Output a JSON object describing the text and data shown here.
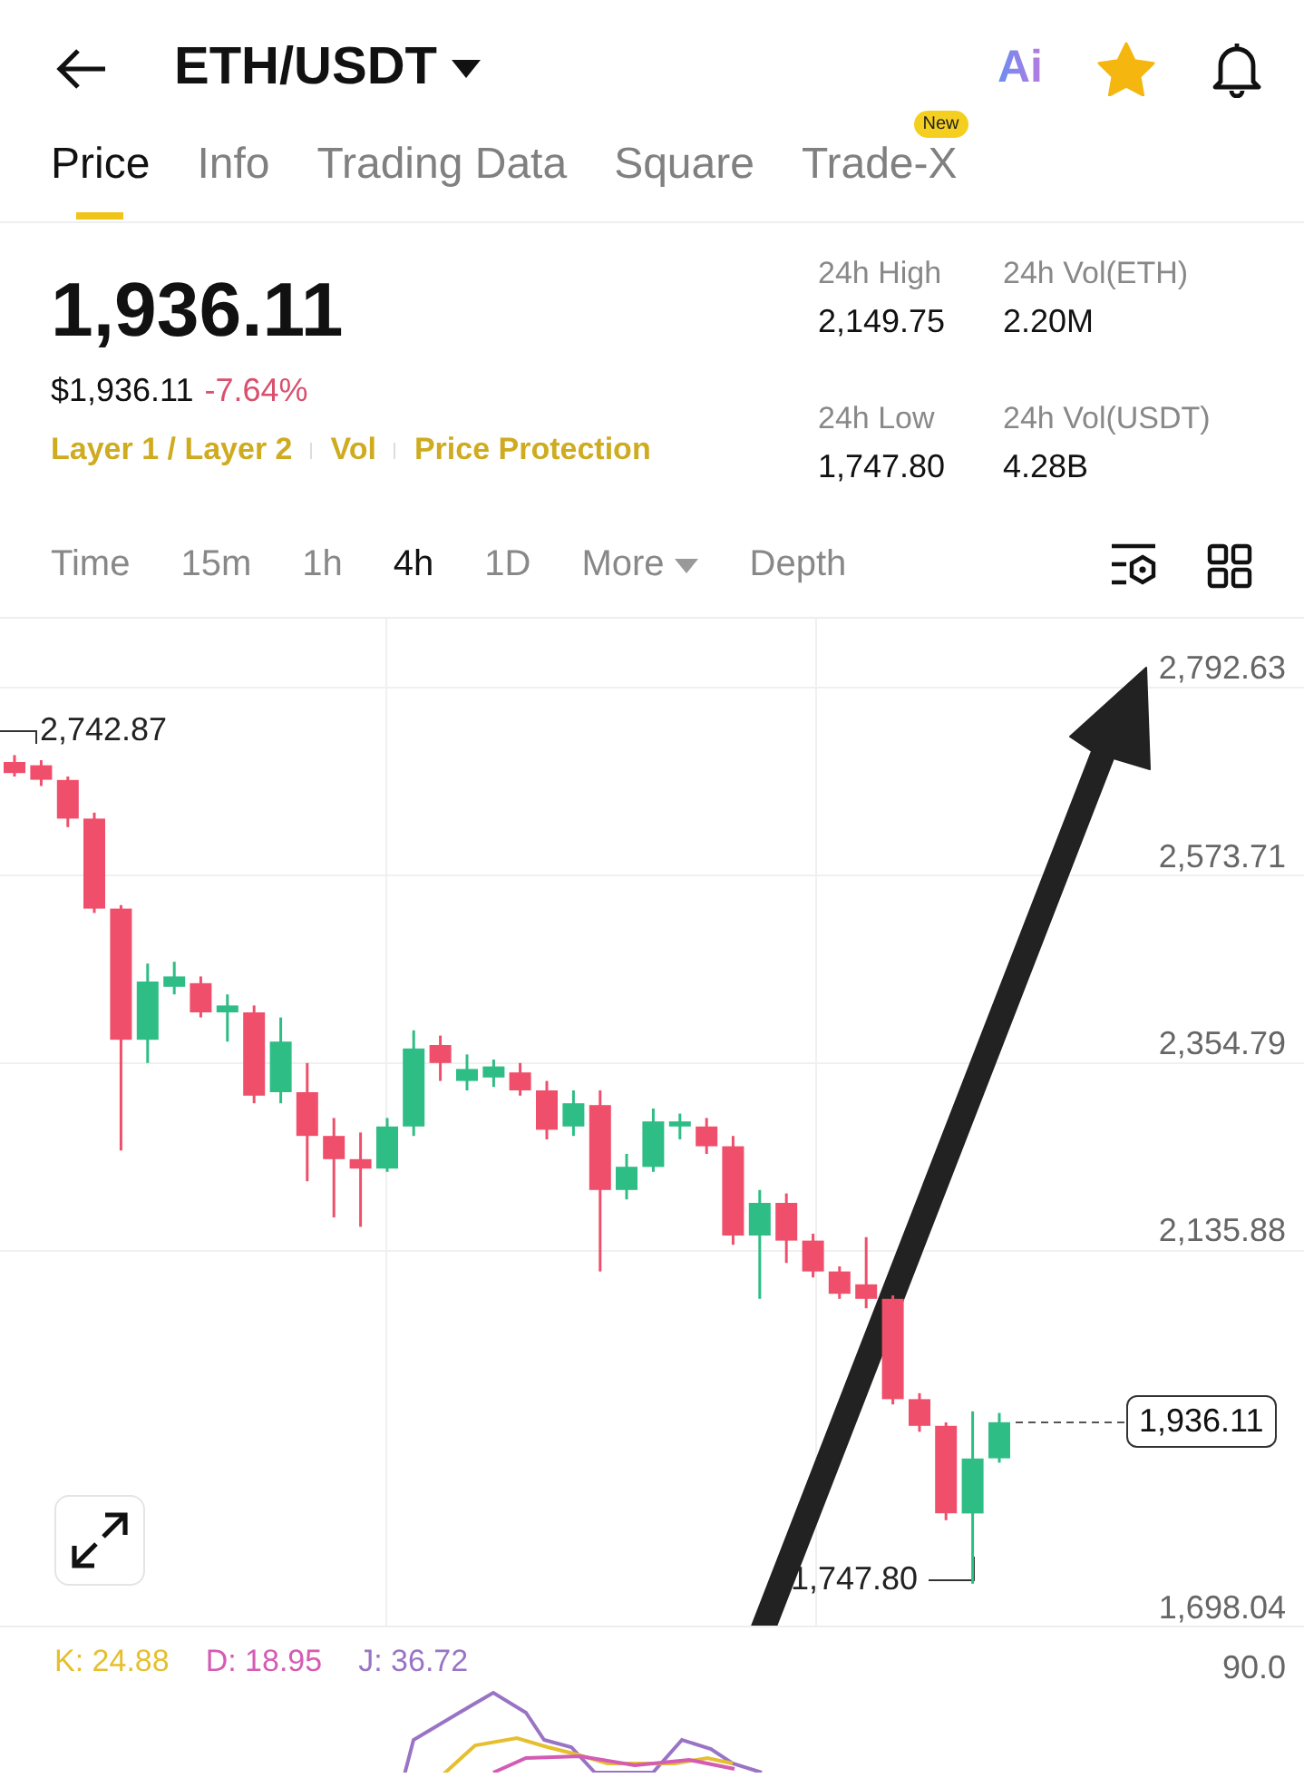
{
  "header": {
    "title": "ETH/USDT",
    "ai_label": "Ai",
    "favorite": true
  },
  "tabs": [
    {
      "label": "Price",
      "selected": true
    },
    {
      "label": "Info",
      "selected": false
    },
    {
      "label": "Trading Data",
      "selected": false
    },
    {
      "label": "Square",
      "selected": false
    },
    {
      "label": "Trade-X",
      "selected": false,
      "badge": "New"
    }
  ],
  "summary": {
    "last_price": "1,936.11",
    "fiat_price": "$1,936.11",
    "change": "-7.64%",
    "tags": [
      "Layer 1 / Layer 2",
      "Vol",
      "Price Protection"
    ]
  },
  "stats": [
    {
      "label": "24h High",
      "value": "2,149.75"
    },
    {
      "label": "24h Vol(ETH)",
      "value": "2.20M"
    },
    {
      "label": "24h Low",
      "value": "1,747.80"
    },
    {
      "label": "24h Vol(USDT)",
      "value": "4.28B"
    }
  ],
  "intervals": [
    {
      "label": "Time",
      "selected": false,
      "kind": "plain"
    },
    {
      "label": "15m",
      "selected": false,
      "kind": "plain"
    },
    {
      "label": "1h",
      "selected": false,
      "kind": "plain"
    },
    {
      "label": "4h",
      "selected": true,
      "kind": "plain"
    },
    {
      "label": "1D",
      "selected": false,
      "kind": "plain"
    },
    {
      "label": "More",
      "selected": false,
      "kind": "dropdown"
    },
    {
      "label": "Depth",
      "selected": false,
      "kind": "plain"
    }
  ],
  "chart": {
    "high_label": "2,742.87",
    "low_label": "1,747.80",
    "last_price_tag": "1,936.11",
    "chart_data": {
      "type": "candlestick",
      "ohlc": [
        [
          2706,
          2714,
          2689,
          2693
        ],
        [
          2702,
          2708,
          2678,
          2685
        ],
        [
          2685,
          2689,
          2630,
          2640
        ],
        [
          2640,
          2647,
          2530,
          2535
        ],
        [
          2535,
          2539,
          2253,
          2382
        ],
        [
          2382,
          2471,
          2355,
          2450
        ],
        [
          2444,
          2473,
          2435,
          2456
        ],
        [
          2448,
          2456,
          2408,
          2414
        ],
        [
          2414,
          2435,
          2380,
          2422
        ],
        [
          2414,
          2422,
          2308,
          2317
        ],
        [
          2321,
          2408,
          2308,
          2380
        ],
        [
          2321,
          2355,
          2217,
          2270
        ],
        [
          2270,
          2291,
          2175,
          2243
        ],
        [
          2243,
          2274,
          2164,
          2232
        ],
        [
          2232,
          2291,
          2228,
          2281
        ],
        [
          2281,
          2393,
          2270,
          2372
        ],
        [
          2376,
          2387,
          2334,
          2355
        ],
        [
          2334,
          2365,
          2323,
          2348
        ],
        [
          2338,
          2359,
          2327,
          2351
        ],
        [
          2344,
          2355,
          2317,
          2323
        ],
        [
          2323,
          2334,
          2266,
          2277
        ],
        [
          2281,
          2323,
          2270,
          2308
        ],
        [
          2306,
          2323,
          2112,
          2207
        ],
        [
          2207,
          2249,
          2196,
          2234
        ],
        [
          2234,
          2302,
          2228,
          2287
        ],
        [
          2281,
          2296,
          2266,
          2287
        ],
        [
          2281,
          2291,
          2249,
          2258
        ],
        [
          2258,
          2270,
          2143,
          2154
        ],
        [
          2154,
          2207,
          2080,
          2192
        ],
        [
          2192,
          2203,
          2122,
          2148
        ],
        [
          2148,
          2156,
          2105,
          2112
        ],
        [
          2112,
          2118,
          2080,
          2086
        ],
        [
          2097,
          2152,
          2069,
          2080
        ],
        [
          2080,
          2084,
          1957,
          1963
        ],
        [
          1963,
          1970,
          1925,
          1932
        ],
        [
          1932,
          1936,
          1822,
          1830
        ],
        [
          1830,
          1949,
          1748,
          1894
        ],
        [
          1894,
          1947,
          1889,
          1936.11
        ]
      ],
      "ylim": [
        1698.04,
        2792.63
      ],
      "grid": true,
      "yticks": [
        {
          "value": 2792.63,
          "label": "2,792.63"
        },
        {
          "value": 2573.71,
          "label": "2,573.71"
        },
        {
          "value": 2354.79,
          "label": "2,354.79"
        },
        {
          "value": 2135.88,
          "label": "2,135.88"
        },
        {
          "value": 1698.04,
          "label": "1,698.04"
        }
      ]
    }
  },
  "indicator": {
    "values": [
      {
        "label": "K: 24.88",
        "color": "#e6bf2e"
      },
      {
        "label": "D: 18.95",
        "color": "#d45cb4"
      },
      {
        "label": "J: 36.72",
        "color": "#9a74c4"
      }
    ],
    "axis": "90.0"
  }
}
